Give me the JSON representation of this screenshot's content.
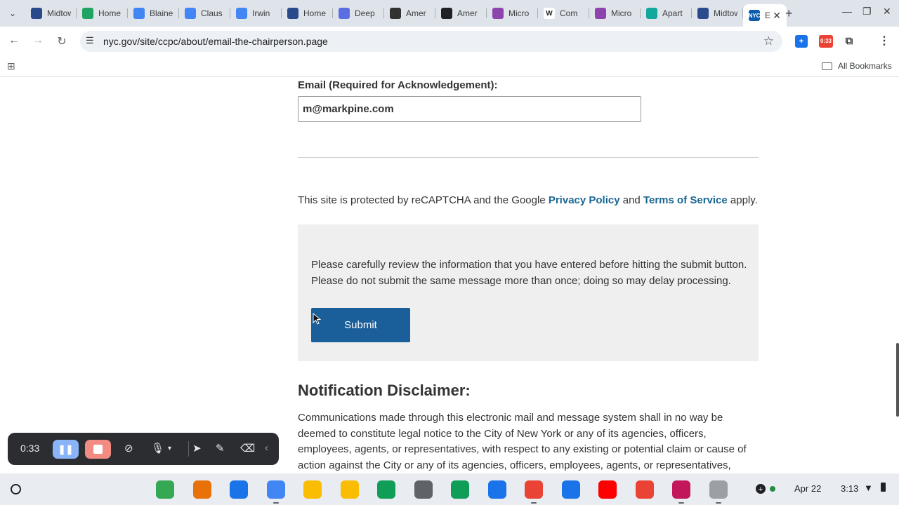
{
  "browser": {
    "tabs": [
      {
        "title": "Midtown",
        "favicon": "rw-logo-icon",
        "color": "#2b4a8c"
      },
      {
        "title": "Home",
        "favicon": "drive-icon",
        "color": "#1fa463"
      },
      {
        "title": "Blaine",
        "favicon": "docs-icon",
        "color": "#4285f4"
      },
      {
        "title": "Claus",
        "favicon": "docs-icon",
        "color": "#4285f4"
      },
      {
        "title": "Irwin",
        "favicon": "docs-icon",
        "color": "#4285f4"
      },
      {
        "title": "Home",
        "favicon": "rw-logo-icon",
        "color": "#2b4a8c"
      },
      {
        "title": "Deep",
        "favicon": "deepl-icon",
        "color": "#5b6ee1"
      },
      {
        "title": "Amer",
        "favicon": "perplexity-icon",
        "color": "#333333"
      },
      {
        "title": "Amer",
        "favicon": "chatgpt-icon",
        "color": "#202124"
      },
      {
        "title": "Micro",
        "favicon": "copilot-icon",
        "color": "#8e44ad"
      },
      {
        "title": "Com",
        "favicon": "wikipedia-icon",
        "color": "#ffffff"
      },
      {
        "title": "Micro",
        "favicon": "copilot-icon",
        "color": "#8e44ad"
      },
      {
        "title": "Apart",
        "favicon": "home-icon",
        "color": "#12a89d"
      },
      {
        "title": "Midtown",
        "favicon": "rw-logo-icon",
        "color": "#2b4a8c"
      }
    ],
    "active_tab": {
      "title": "E",
      "favicon": "nyc-logo-icon",
      "color": "#0b5cad"
    },
    "url": "nyc.gov/site/ccpc/about/email-the-chairperson.page",
    "extension_badge": "0:33",
    "all_bookmarks_label": "All Bookmarks"
  },
  "form": {
    "email_label": "Email (Required for Acknowledgement):",
    "email_value": "m@markpine.com",
    "recaptcha_prefix": "This site is protected by reCAPTCHA and the Google ",
    "privacy_link": "Privacy Policy",
    "recaptcha_and": " and ",
    "terms_link": "Terms of Service",
    "recaptcha_suffix": " apply.",
    "review_line1": "Please carefully review the information that you have entered before hitting the submit button.",
    "review_line2": "Please do not submit the same message more than once; doing so may delay processing.",
    "submit_label": "Submit"
  },
  "disclaimer": {
    "heading": "Notification Disclaimer:",
    "body": "Communications made through this electronic mail and message system shall in no way be deemed to constitute legal notice to the City of New York or any of its agencies, officers, employees, agents, or representatives, with respect to any existing or potential claim or cause of action against the City or any of its agencies, officers, employees, agents, or representatives, where"
  },
  "recorder": {
    "timer": "0:33"
  },
  "shelf": {
    "apps": [
      {
        "name": "maps-icon",
        "color": "#34a853"
      },
      {
        "name": "chrome-canary-icon",
        "color": "#e8710a"
      },
      {
        "name": "tasks-icon",
        "color": "#1a73e8"
      },
      {
        "name": "docs-icon",
        "color": "#4285f4"
      },
      {
        "name": "drive-icon",
        "color": "#fbbc04"
      },
      {
        "name": "keep-icon",
        "color": "#fbbc04"
      },
      {
        "name": "classroom-icon",
        "color": "#0f9d58"
      },
      {
        "name": "settings-icon",
        "color": "#5f6368"
      },
      {
        "name": "sheets-icon",
        "color": "#0f9d58"
      },
      {
        "name": "files-icon",
        "color": "#1a73e8"
      },
      {
        "name": "chrome-icon",
        "color": "#ea4335"
      },
      {
        "name": "calendar-icon",
        "color": "#1a73e8"
      },
      {
        "name": "youtube-icon",
        "color": "#ff0000"
      },
      {
        "name": "gmail-icon",
        "color": "#ea4335"
      },
      {
        "name": "screen-recorder-icon",
        "color": "#c2185b"
      },
      {
        "name": "tote-icon",
        "color": "#9aa0a6"
      }
    ],
    "date": "Apr 22",
    "time": "3:13"
  }
}
